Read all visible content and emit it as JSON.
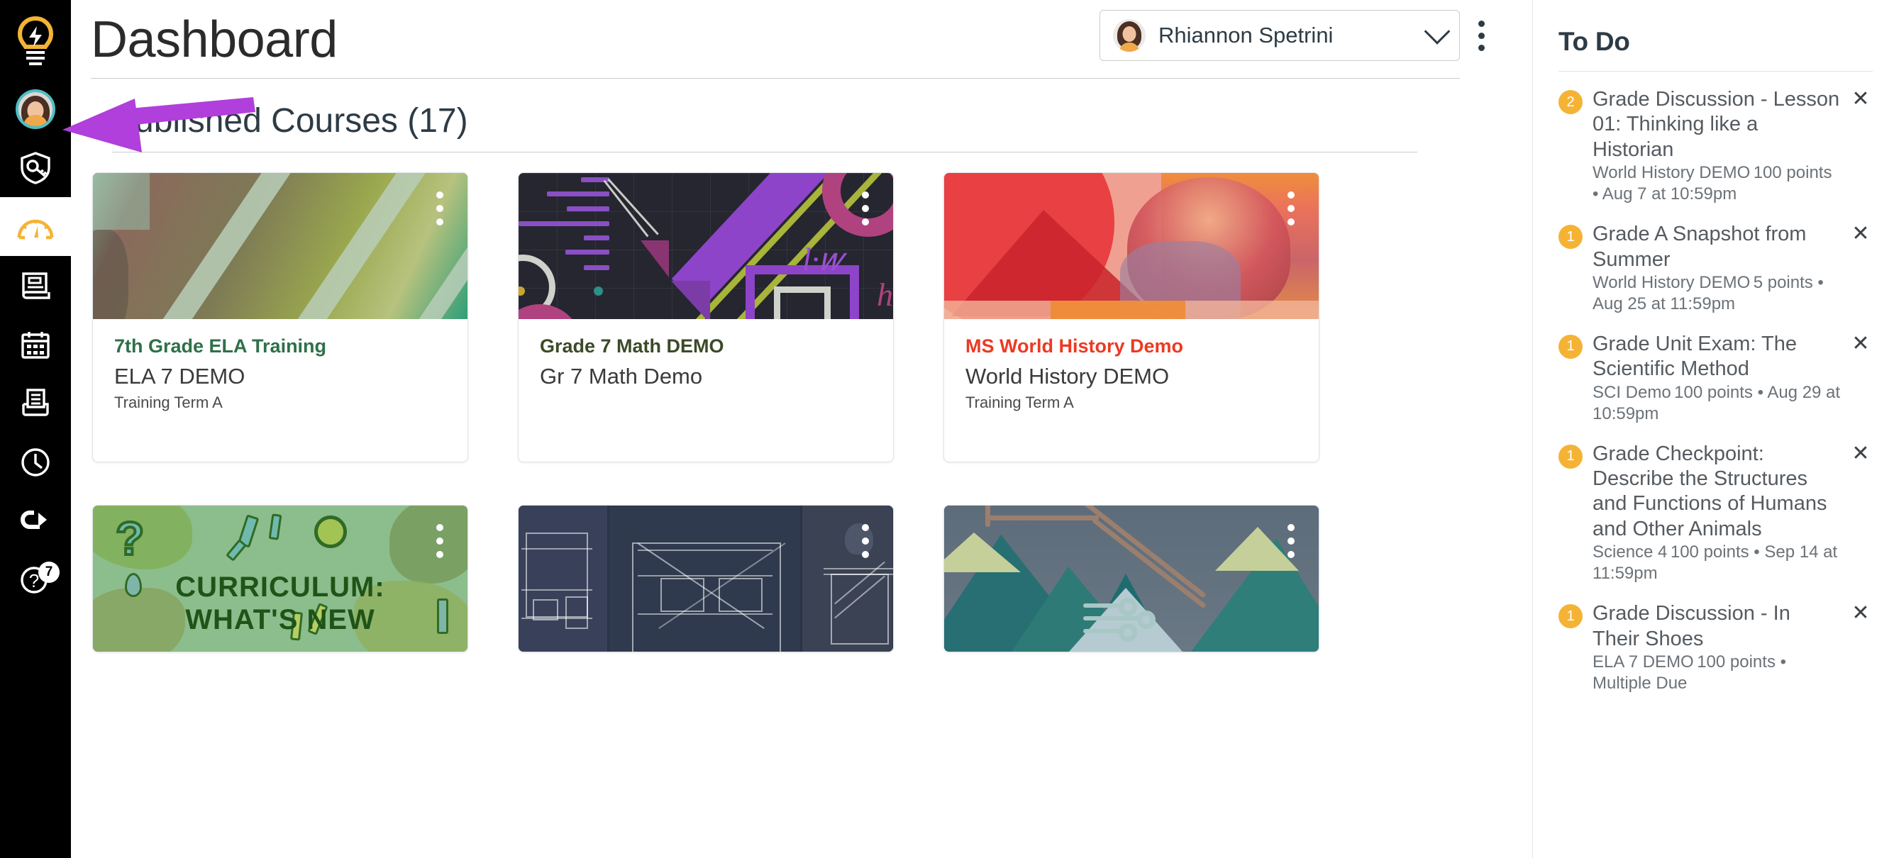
{
  "global_nav": {
    "items": [
      {
        "label": "Canvas",
        "icon": "lightbulb-icon",
        "active": false
      },
      {
        "label": "Account",
        "icon": "user-avatar-icon",
        "active": false
      },
      {
        "label": "Admin",
        "icon": "shield-key-icon",
        "active": false
      },
      {
        "label": "Dashboard",
        "icon": "gauge-icon",
        "active": true
      },
      {
        "label": "Courses",
        "icon": "book-icon",
        "active": false
      },
      {
        "label": "Calendar",
        "icon": "calendar-icon",
        "active": false
      },
      {
        "label": "Inbox",
        "icon": "inbox-icon",
        "active": false
      },
      {
        "label": "History",
        "icon": "clock-icon",
        "active": false
      },
      {
        "label": "Commons",
        "icon": "commons-arrow-icon",
        "active": false
      },
      {
        "label": "Help",
        "icon": "question-mark-icon",
        "active": false,
        "badge": "7"
      }
    ]
  },
  "header": {
    "title": "Dashboard",
    "observee_select": {
      "value": "Rhiannon Spetrini",
      "chevron": "chevron-down-icon"
    },
    "options_menu": "dashboard-options-kebab"
  },
  "main": {
    "section_title": "Published Courses (17)",
    "cards": [
      {
        "link": "7th Grade ELA Training",
        "link_color": "#2e7048",
        "nickname": "ELA 7 DEMO",
        "term": "Training Term A",
        "art": "ela"
      },
      {
        "link": "Grade 7 Math DEMO",
        "link_color": "#3c4a28",
        "nickname": "Gr 7 Math Demo",
        "term": "",
        "art": "math"
      },
      {
        "link": "MS World History Demo",
        "link_color": "#ec3a23",
        "nickname": "World History DEMO",
        "term": "Training Term A",
        "art": "history"
      },
      {
        "link": "",
        "nickname": "",
        "term": "",
        "art": "curriculum"
      },
      {
        "link": "",
        "nickname": "",
        "term": "",
        "art": "ushistory"
      },
      {
        "link": "",
        "nickname": "",
        "term": "",
        "art": "science"
      }
    ]
  },
  "todo": {
    "title": "To Do",
    "items": [
      {
        "count": "2",
        "title": "Grade Discussion - Lesson 01: Thinking like a Historian",
        "course": "World History DEMO",
        "meta": "100 points • Aug 7 at 10:59pm",
        "dismiss": "close-icon"
      },
      {
        "count": "1",
        "title": "Grade A Snapshot from Summer",
        "course": "World History DEMO",
        "meta": "5 points • Aug 25 at 11:59pm",
        "dismiss": "close-icon"
      },
      {
        "count": "1",
        "title": "Grade Unit Exam: The Scientific Method",
        "course": "SCI Demo",
        "meta": "100 points • Aug 29 at 10:59pm",
        "dismiss": "close-icon"
      },
      {
        "count": "1",
        "title": "Grade Checkpoint: Describe the Structures and Functions of Humans and Other Animals",
        "course": "Science 4",
        "meta": "100 points • Sep 14 at 11:59pm",
        "dismiss": "close-icon"
      },
      {
        "count": "1",
        "title": "Grade Discussion - In Their Shoes",
        "course": "ELA 7 DEMO",
        "meta": "100 points • Multiple Due",
        "dismiss": "close-icon"
      }
    ]
  },
  "annotation": {
    "type": "arrow",
    "color": "#b03fdb",
    "points_to": "global-nav-account-avatar"
  },
  "colors": {
    "nav_background": "#000000",
    "badge_yellow": "#f5b335",
    "accent_purple": "#b03fdb"
  }
}
